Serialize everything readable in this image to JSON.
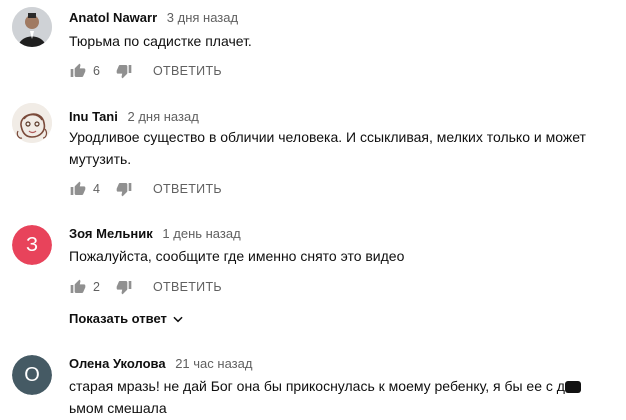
{
  "comments": [
    {
      "author": "Anatol Nawarr",
      "time": "3 дня назад",
      "text": "Тюрьма по садистке плачет.",
      "likes": "6",
      "reply_label": "ОТВЕТИТЬ",
      "avatar": {
        "type": "photo",
        "color": "#3b3b3b"
      }
    },
    {
      "author": "Inu Tani",
      "time": "2 дня назад",
      "text": "Уродливое существо в обличии человека. И ссыкливая, мелких только и может мутузить.",
      "likes": "4",
      "reply_label": "ОТВЕТИТЬ",
      "avatar": {
        "type": "drawing",
        "color": "#e9e3dc"
      }
    },
    {
      "author": "Зоя Мельник",
      "time": "1 день назад",
      "text": "Пожалуйста, сообщите где именно снято это видео",
      "likes": "2",
      "reply_label": "ОТВЕТИТЬ",
      "avatar": {
        "type": "letter",
        "letter": "З",
        "color": "#e8435b"
      },
      "show_replies_label": "Показать ответ"
    },
    {
      "author": "Олена Уколова",
      "time": "21 час назад",
      "text_before": "старая мразь! не дай Бог она бы прикоснулась к моему ребенку, я бы ее с д",
      "text_after": "ьмом смешала",
      "avatar": {
        "type": "letter",
        "letter": "О",
        "color": "#455a64"
      }
    }
  ],
  "icons": {
    "like": "thumb-up-icon",
    "dislike": "thumb-down-icon",
    "expand": "chevron-down-icon"
  }
}
